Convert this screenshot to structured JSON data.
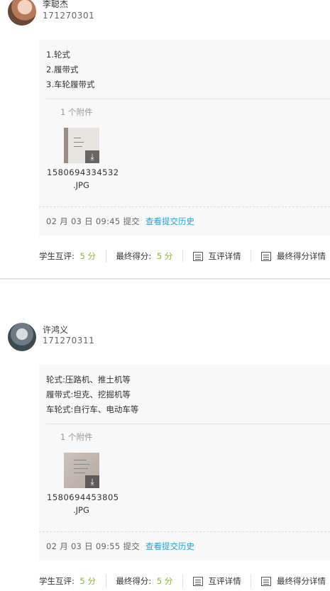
{
  "submissions": [
    {
      "name": "李聪杰",
      "student_id": "171270301",
      "answer_lines": [
        "1.轮式",
        "2.履带式",
        "3.车轮履带式"
      ],
      "attachment_count": "1 个附件",
      "file_name": "1580694334532",
      "file_ext": ".JPG",
      "submit_time": "02 月 03 日 09:45 提交",
      "history_link": "查看提交历史",
      "peer_label": "学生互评:",
      "peer_score": "5 分",
      "final_label": "最终得分:",
      "final_score": "5 分",
      "peer_detail": "互评详情",
      "final_detail": "最终得分详情"
    },
    {
      "name": "许鸿义",
      "student_id": "171270311",
      "answer_lines": [
        "轮式:压路机、推土机等",
        "履带式:坦克、挖掘机等",
        "车轮式:自行车、电动车等"
      ],
      "attachment_count": "1 个附件",
      "file_name": "1580694453805",
      "file_ext": ".JPG",
      "submit_time": "02 月 03 日 09:55 提交",
      "history_link": "查看提交历史",
      "peer_label": "学生互评:",
      "peer_score": "5 分",
      "final_label": "最终得分:",
      "final_score": "5 分",
      "peer_detail": "互评详情",
      "final_detail": "最终得分详情"
    }
  ],
  "icons": {
    "download": "download-icon",
    "list": "list-icon"
  },
  "colors": {
    "link": "#2a9fd6",
    "score": "#8cb43c"
  }
}
